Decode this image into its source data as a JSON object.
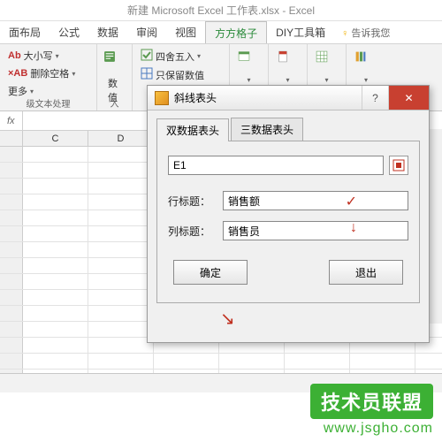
{
  "title": "新建 Microsoft Excel 工作表.xlsx - Excel",
  "ribbon_tabs": {
    "layout": "面布局",
    "formulas": "公式",
    "data": "数据",
    "review": "审阅",
    "view": "视图",
    "fangfang": "方方格子",
    "diy": "DIY工具箱"
  },
  "tell_me": "告诉我您",
  "ribbon": {
    "case": "大小写",
    "del_space": "删除空格",
    "more": "更多",
    "text_group": "级文本处理",
    "numval": "数值",
    "entry": "入",
    "round": "四舍五入",
    "keep_only": "只保留数值"
  },
  "fx": "fx",
  "cols": {
    "c": "C",
    "d": "D"
  },
  "dialog": {
    "title": "斜线表头",
    "tabs": {
      "two": "双数据表头",
      "three": "三数据表头"
    },
    "ref_value": "E1",
    "row_label": "行标题：",
    "row_value": "销售额",
    "col_label": "列标题：",
    "col_value": "销售员",
    "ok": "确定",
    "cancel": "退出"
  },
  "watermark": {
    "badge": "技术员联盟",
    "url": "www.jsgho.com"
  }
}
